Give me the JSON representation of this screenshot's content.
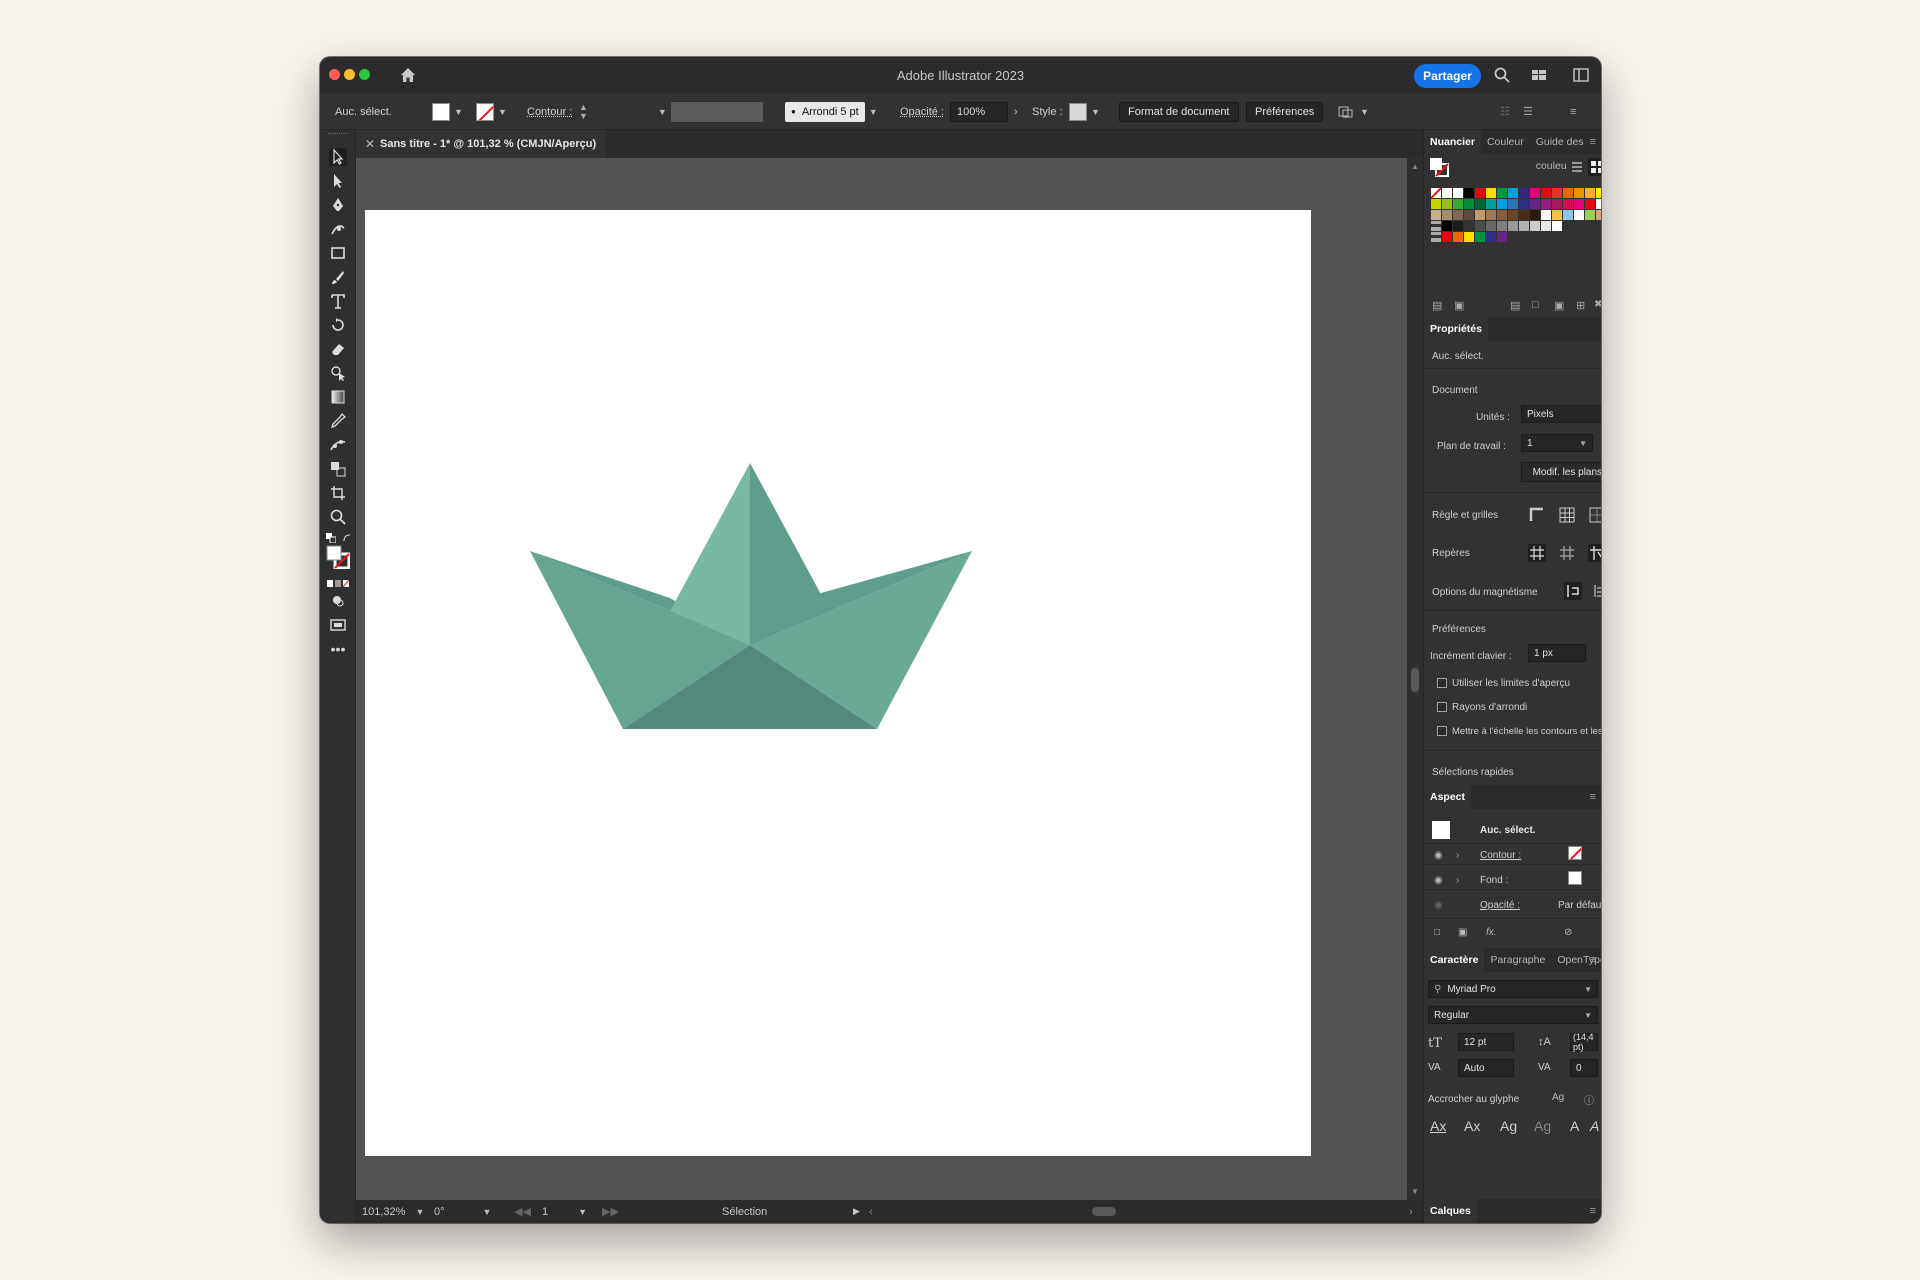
{
  "window": {
    "title": "Adobe Illustrator 2023",
    "share_label": "Partager"
  },
  "control_bar": {
    "selection": "Auc. sélect.",
    "stroke_label": "Contour :",
    "brush": "Arrondi 5 pt",
    "opacity_label": "Opacité :",
    "opacity_value": "100%",
    "style_label": "Style :",
    "doc_setup": "Format de document",
    "preferences": "Préférences"
  },
  "document_tab": {
    "title": "Sans titre - 1* @ 101,32 % (CMJN/Aperçu)"
  },
  "status_bar": {
    "zoom": "101,32%",
    "rotation": "0°",
    "artboard": "1",
    "tool": "Sélection"
  },
  "swatches_panel": {
    "tabs": [
      "Nuancier",
      "Couleur",
      "Guide des couleu"
    ],
    "rows": [
      [
        "none",
        "#ffffff",
        "#ffffff",
        "#000000",
        "#e20613",
        "#ffde00",
        "#009640",
        "#009fe3",
        "#312783",
        "#e6007e",
        "#e30613",
        "#e6332a",
        "#ec6608",
        "#f39200",
        "#f9b233",
        "#ffed00"
      ],
      [
        "#c6d300",
        "#95c11f",
        "#3aaa35",
        "#008d36",
        "#006633",
        "#00a19a",
        "#009fe3",
        "#2d73b8",
        "#2d2e83",
        "#662483",
        "#951b81",
        "#a3195b",
        "#d60b52",
        "#e6007e",
        "#e30613",
        "#ffffff"
      ],
      [
        "#c8b08c",
        "#a58c6f",
        "#7d6a55",
        "#5b4c3f",
        "#c49a6c",
        "#a0784f",
        "#875d3b",
        "#6b4424",
        "#4a2c16",
        "#2a1a0e",
        "#f8f8f8",
        "#f6c445",
        "#8ec6ea",
        "#ffffff",
        "#9ccf5b",
        "#d7a37e"
      ],
      [
        "folder",
        "#000000",
        "#1a1a1a",
        "#333333",
        "#4d4d4d",
        "#666666",
        "#808080",
        "#999999",
        "#b3b3b3",
        "#cccccc",
        "#e6e6e6",
        "#ffffff",
        "",
        "",
        "",
        ""
      ],
      [
        "folder",
        "#e20613",
        "#ec6608",
        "#ffde00",
        "#009640",
        "#2d2e83",
        "#662483",
        "",
        "",
        "",
        "",
        "",
        "",
        "",
        "",
        ""
      ]
    ]
  },
  "properties_panel": {
    "title": "Propriétés",
    "no_selection": "Auc. sélect.",
    "document_section": "Document",
    "units_label": "Unités :",
    "units_value": "Pixels",
    "artboard_label": "Plan de travail :",
    "artboard_value": "1",
    "edit_artboards": "Modif. les plans de travail",
    "rulers_grids": "Règle et grilles",
    "guides": "Repères",
    "snap_options": "Options du magnétisme",
    "preferences_section": "Préférences",
    "keyboard_increment_label": "Incrément clavier :",
    "keyboard_increment_value": "1 px",
    "opt_preview_bounds": "Utiliser les limites d'aperçu",
    "opt_corner_radius": "Rayons d'arrondi",
    "opt_scale_strokes": "Mettre à l'échelle les contours et les effets",
    "quick_actions": "Sélections rapides"
  },
  "appearance_panel": {
    "title": "Aspect",
    "no_selection": "Auc. sélect.",
    "stroke_label": "Contour :",
    "fill_label": "Fond :",
    "opacity_label": "Opacité :",
    "opacity_value": "Par défaut"
  },
  "character_panel": {
    "tabs": [
      "Caractère",
      "Paragraphe",
      "OpenType"
    ],
    "font_family": "Myriad Pro",
    "font_style": "Regular",
    "font_size": "12 pt",
    "leading": "(14,4 pt)",
    "kerning": "Auto",
    "tracking": "0",
    "snap_to_glyph": "Accrocher au glyphe"
  },
  "layers_panel": {
    "title": "Calques"
  },
  "artwork": {
    "description_colors": [
      "#79b8a3",
      "#5f9d8c",
      "#66a591",
      "#6aa996",
      "#538a7b"
    ]
  }
}
